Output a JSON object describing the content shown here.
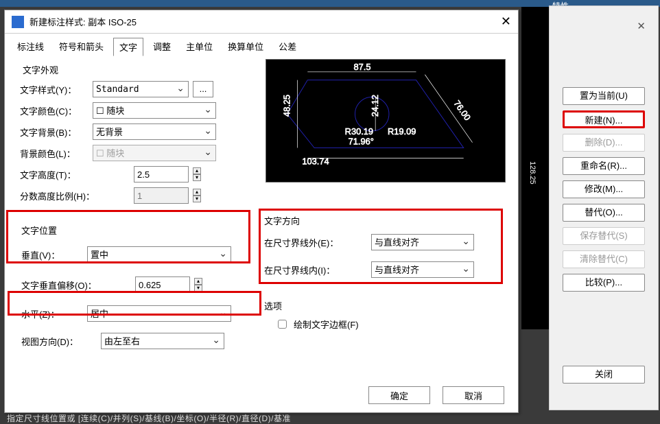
{
  "dialog": {
    "title": "新建标注样式: 副本 ISO-25",
    "close_glyph": "✕",
    "tabs": [
      "标注线",
      "符号和箭头",
      "文字",
      "调整",
      "主单位",
      "换算单位",
      "公差"
    ],
    "active_tab": "文字",
    "appearance": {
      "group_title": "文字外观",
      "style_label": "文字样式(Y)：",
      "style_value": "Standard",
      "style_more": "...",
      "color_label": "文字颜色(C)：",
      "color_value": "随块",
      "bg_label": "文字背景(B)：",
      "bg_value": "无背景",
      "bgcolor_label": "背景颜色(L)：",
      "bgcolor_value": "随块",
      "height_label": "文字高度(T)：",
      "height_value": "2.5",
      "fraction_label": "分数高度比例(H)：",
      "fraction_value": "1"
    },
    "position": {
      "group_title": "文字位置",
      "vertical_label": "垂直(V)：",
      "vertical_value": "置中",
      "offset_label": "文字垂直偏移(O)：",
      "offset_value": "0.625",
      "horizontal_label": "水平(Z)：",
      "horizontal_value": "居中",
      "viewdir_label": "视图方向(D)：",
      "viewdir_value": "由左至右"
    },
    "direction": {
      "group_title": "文字方向",
      "ext_out_label": "在尺寸界线外(E)：",
      "ext_out_value": "与直线对齐",
      "ext_in_label": "在尺寸界线内(I)：",
      "ext_in_value": "与直线对齐"
    },
    "options": {
      "group_title": "选项",
      "draw_border_label": "绘制文字边框(F)"
    },
    "buttons": {
      "ok": "确定",
      "cancel": "取消"
    },
    "preview_dims": {
      "top": "87.5",
      "left": "48.25",
      "inner_v": "24.12",
      "right": "76.00",
      "chord": "R30.19",
      "radius": "R19.09",
      "angle": "71.96°",
      "bottom": "103.74"
    }
  },
  "right": {
    "top_title": "特性",
    "set_current": "置为当前(U)",
    "new": "新建(N)...",
    "delete": "删除(D)...",
    "rename": "重命名(R)...",
    "modify": "修改(M)...",
    "override": "替代(O)...",
    "save_override": "保存替代(S)",
    "clear_override": "清除替代(C)",
    "compare": "比较(P)...",
    "close": "关闭"
  },
  "outer": {
    "side_dim": "128.25",
    "status": "指定尺寸线位置或 [连续(C)/并列(S)/基线(B)/坐标(O)/半径(R)/直径(D)/基准"
  }
}
